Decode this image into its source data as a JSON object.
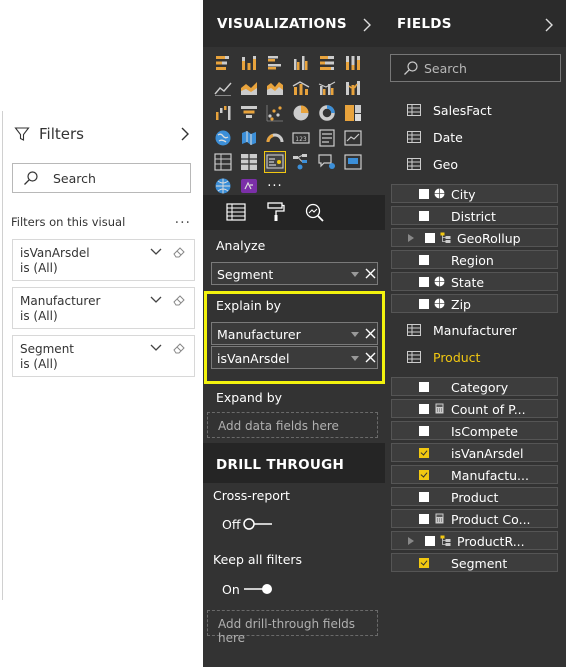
{
  "filters_pane": {
    "title": "Filters",
    "search_placeholder": "Search",
    "section_label": "Filters on this visual",
    "more": "...",
    "cards": [
      {
        "name": "isVanArsdel",
        "value": "is (All)"
      },
      {
        "name": "Manufacturer",
        "value": "is (All)"
      },
      {
        "name": "Segment",
        "value": "is (All)"
      }
    ]
  },
  "visualizations_pane": {
    "title": "VISUALIZATIONS",
    "selected_visual": "key-influencers-icon",
    "more_visuals": "...",
    "analyze": {
      "label": "Analyze",
      "field": "Segment"
    },
    "explain_by": {
      "label": "Explain by",
      "fields": [
        "Manufacturer",
        "isVanArsdel"
      ]
    },
    "expand_by": {
      "label": "Expand by",
      "placeholder": "Add data fields here"
    },
    "drill_through": {
      "title": "DRILL THROUGH",
      "cross_report": {
        "label": "Cross-report",
        "state": "Off"
      },
      "keep_all_filters": {
        "label": "Keep all filters",
        "state": "On"
      },
      "placeholder": "Add drill-through fields here"
    }
  },
  "fields_pane": {
    "title": "FIELDS",
    "search_placeholder": "Search",
    "tables_top": [
      "SalesFact",
      "Date",
      "Geo"
    ],
    "geo_fields": [
      {
        "name": "City",
        "checked": false
      },
      {
        "name": "District",
        "checked": false
      },
      {
        "name": "GeoRollup",
        "checked": false
      },
      {
        "name": "Region",
        "checked": false
      },
      {
        "name": "State",
        "checked": false
      },
      {
        "name": "Zip",
        "checked": false
      }
    ],
    "tables_mid": [
      "Manufacturer",
      "Product"
    ],
    "product_fields": [
      {
        "name": "Category",
        "checked": false
      },
      {
        "name": "Count of P...",
        "checked": false
      },
      {
        "name": "IsCompete",
        "checked": false
      },
      {
        "name": "isVanArsdel",
        "checked": true
      },
      {
        "name": "Manufactu...",
        "checked": true
      },
      {
        "name": "Product",
        "checked": false
      },
      {
        "name": "Product Co...",
        "checked": false
      },
      {
        "name": "ProductR...",
        "checked": false
      },
      {
        "name": "Segment",
        "checked": true
      }
    ]
  },
  "colors": {
    "accent_yellow": "#f2c811",
    "highlight_box": "#f2f20e",
    "pane_dark": "#333333",
    "band_dark": "#252525"
  }
}
